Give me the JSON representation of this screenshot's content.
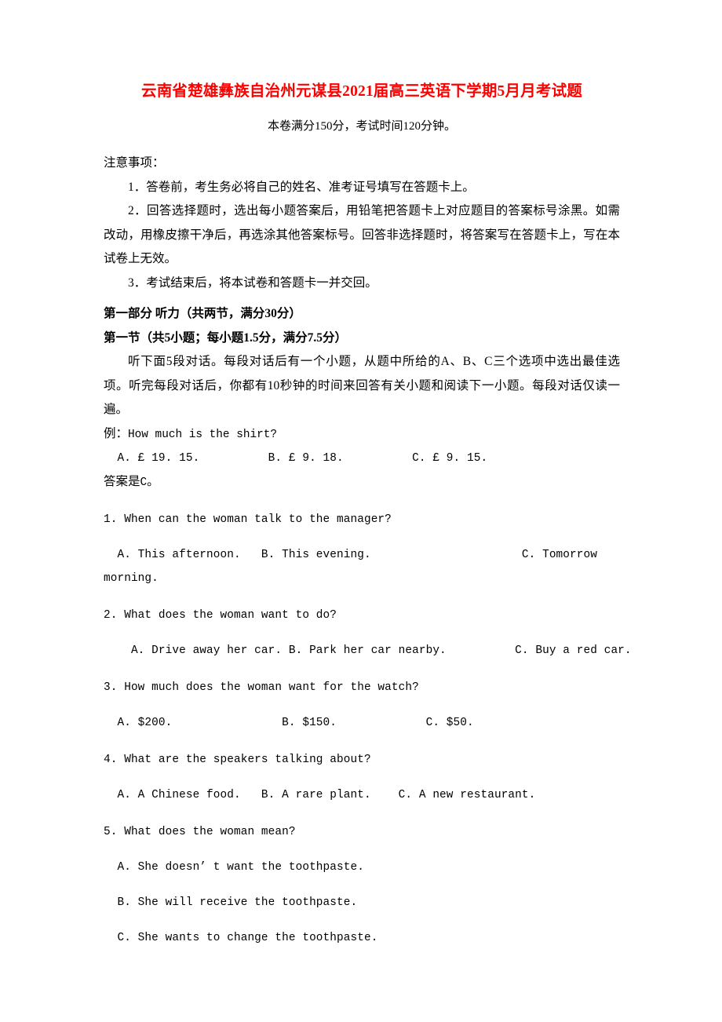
{
  "document": {
    "title": "云南省楚雄彝族自治州元谋县2021届高三英语下学期5月月考试题",
    "subtitle": "本卷满分150分，考试时间120分钟。",
    "title_color": "#FF0000"
  },
  "notes": {
    "heading": "注意事项：",
    "items": [
      "1．答卷前，考生务必将自己的姓名、准考证号填写在答题卡上。",
      "2．回答选择题时，选出每小题答案后，用铅笔把答题卡上对应题目的答案标号涂黑。如需改动，用橡皮擦干净后，再选涂其他答案标号。回答非选择题时，将答案写在答题卡上，写在本试卷上无效。",
      "3．考试结束后，将本试卷和答题卡一并交回。"
    ]
  },
  "part_one": {
    "heading": "第一部分 听力（共两节，满分30分）",
    "section_heading": "第一节（共5小题；每小题1.5分，满分7.5分）",
    "instructions": "听下面5段对话。每段对话后有一个小题，从题中所给的A、B、C三个选项中选出最佳选项。听完每段对话后，你都有10秒钟的时间来回答有关小题和阅读下一小题。每段对话仅读一遍。",
    "example": {
      "label": "例：",
      "stem": "How much is the shirt?",
      "options_line": "  A. £ 19. 15.          B. £ 9. 18.          C. £ 9. 15.",
      "answer_label": "答案是",
      "answer_value": "C",
      "answer_suffix": "。"
    }
  },
  "questions": [
    {
      "stem": "1. When can the woman talk to the manager?",
      "option_lines": [
        "  A. This afternoon.   B. This evening.                      C. Tomorrow",
        "morning."
      ]
    },
    {
      "stem": "2. What does the woman want to do?",
      "option_lines": [
        "    A. Drive away her car. B. Park her car nearby.          C. Buy a red car."
      ]
    },
    {
      "stem": "3. How much does the woman want for the watch?",
      "option_lines": [
        "  A. $200.                B. $150.             C. $50."
      ]
    },
    {
      "stem": "4. What are the speakers talking about?",
      "option_lines": [
        "  A. A Chinese food.   B. A rare plant.    C. A new restaurant."
      ]
    },
    {
      "stem": "5. What does the woman mean?",
      "option_lines": [
        "  A. She doesn’ t want the toothpaste.",
        "  B. She will receive the toothpaste.",
        "  C. She wants to change the toothpaste."
      ]
    }
  ]
}
